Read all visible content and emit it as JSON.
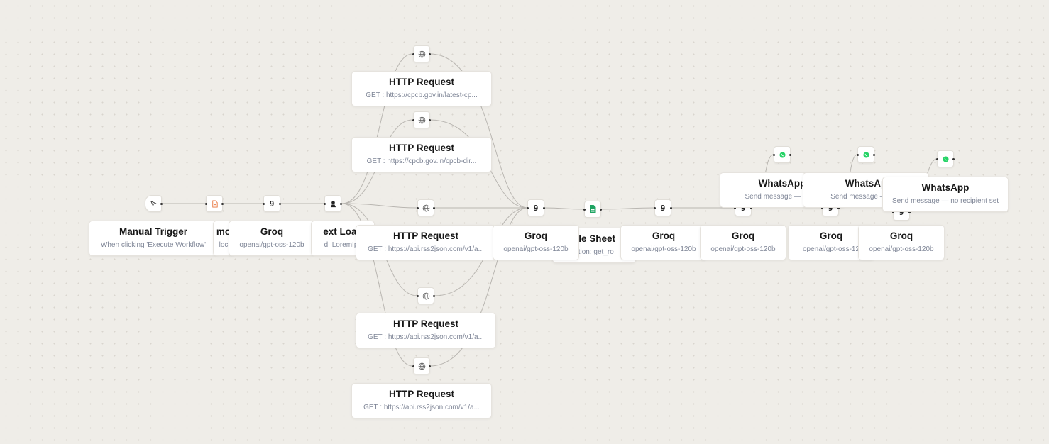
{
  "nodes": {
    "manual_trigger": {
      "title": "Manual Trigger",
      "subtitle": "When clicking 'Execute Workflow'"
    },
    "pdf_loader": {
      "title": "mo",
      "subtitle": "loc"
    },
    "groq_1": {
      "title": "Groq",
      "subtitle": "openai/gpt-oss-120b"
    },
    "text_loader": {
      "title": "ext Load",
      "subtitle": "d: LoremIps"
    },
    "http_1": {
      "title": "HTTP Request",
      "subtitle": "GET : https://cpcb.gov.in/latest-cp..."
    },
    "http_2": {
      "title": "HTTP Request",
      "subtitle": "GET : https://cpcb.gov.in/cpcb-dir..."
    },
    "http_3": {
      "title": "HTTP Request",
      "subtitle": "GET : https://api.rss2json.com/v1/a..."
    },
    "http_4": {
      "title": "HTTP Request",
      "subtitle": "GET : https://api.rss2json.com/v1/a..."
    },
    "http_5": {
      "title": "HTTP Request",
      "subtitle": "GET : https://api.rss2json.com/v1/a..."
    },
    "groq_2": {
      "title": "Groq",
      "subtitle": "openai/gpt-oss-120b"
    },
    "google_sheets": {
      "title": "gle Sheet",
      "subtitle": "ation: get_ro"
    },
    "groq_3": {
      "title": "Groq",
      "subtitle": "openai/gpt-oss-120b"
    },
    "groq_4": {
      "title": "Groq",
      "subtitle": "openai/gpt-oss-120b"
    },
    "groq_5": {
      "title": "Groq",
      "subtitle": "openai/gpt-oss-12"
    },
    "groq_6": {
      "title": "Groq",
      "subtitle": "openai/gpt-oss-120b"
    },
    "whatsapp_1": {
      "title": "WhatsApp",
      "subtitle": "Send message — no re"
    },
    "whatsapp_2": {
      "title": "WhatsAp",
      "subtitle": "Send message — no r"
    },
    "whatsapp_3": {
      "title": "WhatsApp",
      "subtitle": "Send message — no recipient set"
    }
  },
  "icons": {
    "manual_trigger": "cursor-click-icon",
    "pdf_loader": "pdf-file-icon",
    "groq": "groq-logo-icon",
    "text_loader": "text-loader-icon",
    "http_request": "globe-icon",
    "google_sheets": "google-sheets-icon",
    "whatsapp": "whatsapp-icon"
  },
  "colors": {
    "canvas_background": "#efede8",
    "edge": "#b9b6b1",
    "pdf_accent": "#e8743b",
    "sheets_green": "#1fa463",
    "whatsapp_green": "#25d366"
  }
}
